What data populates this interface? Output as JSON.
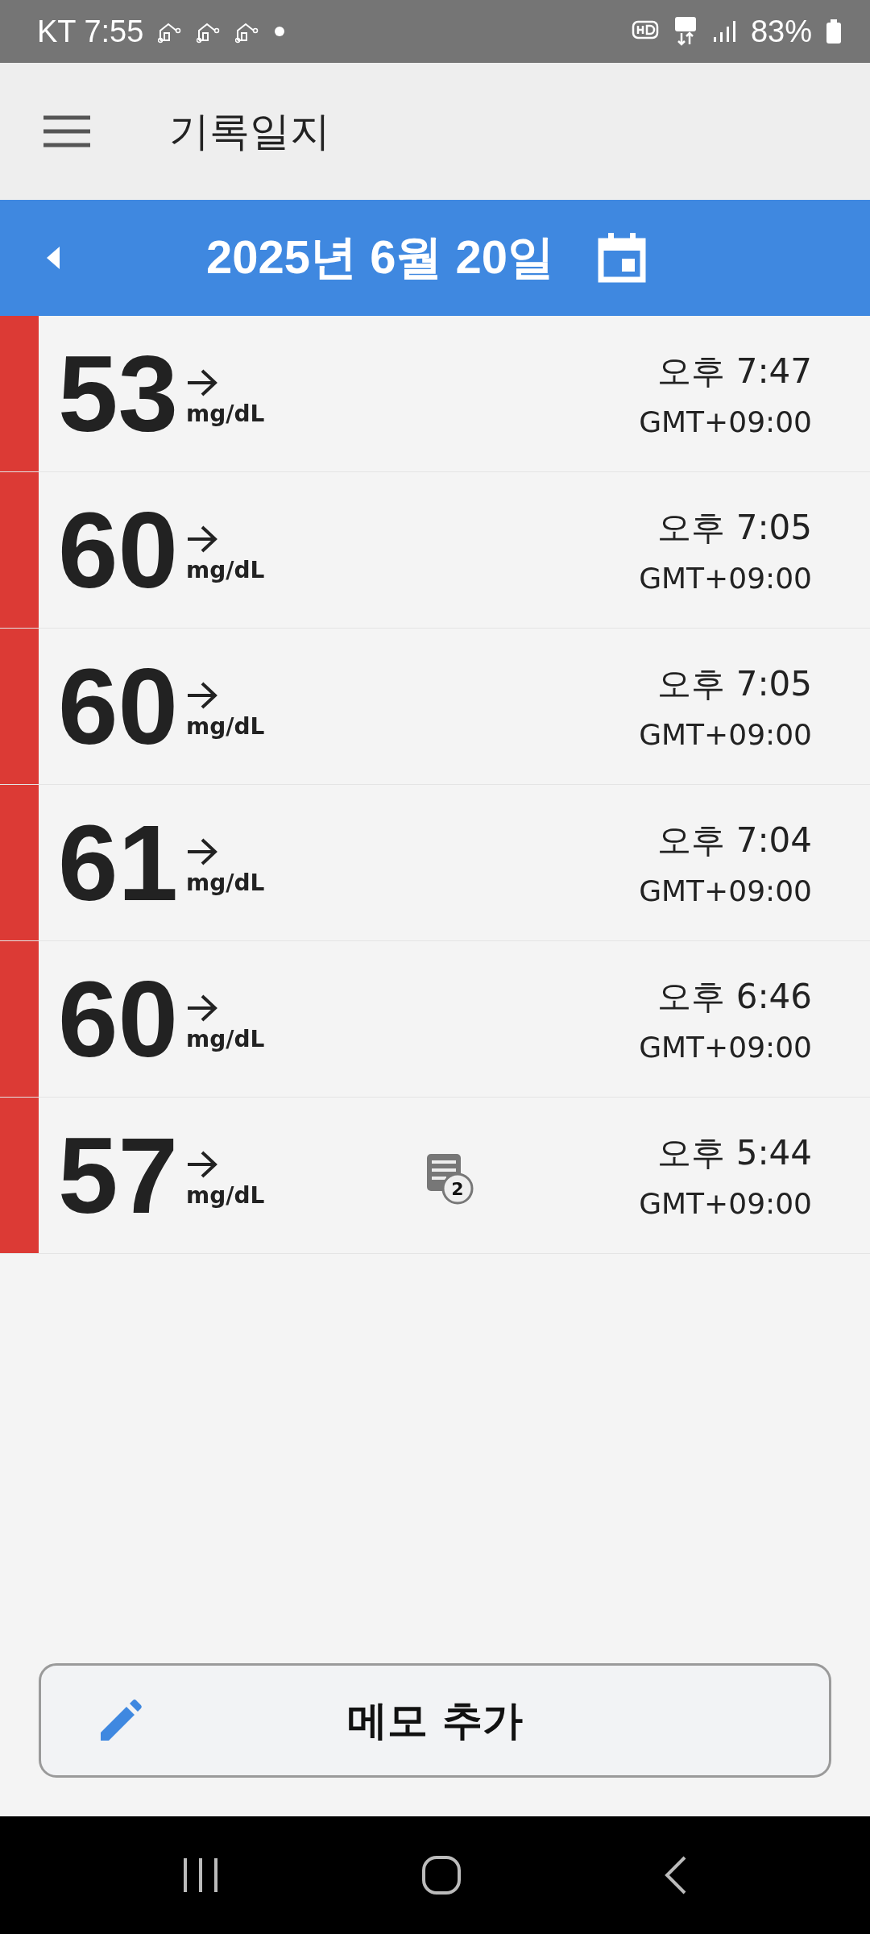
{
  "status_bar": {
    "carrier_time": "KT 7:55",
    "battery": "83%"
  },
  "app_bar": {
    "title": "기록일지"
  },
  "date_bar": {
    "date": "2025년 6월 20일"
  },
  "readings": [
    {
      "value": "53",
      "unit": "mg/dL",
      "time": "오후 7:47",
      "timezone": "GMT+09:00",
      "color": "#dc3a35"
    },
    {
      "value": "60",
      "unit": "mg/dL",
      "time": "오후 7:05",
      "timezone": "GMT+09:00",
      "color": "#dc3a35"
    },
    {
      "value": "60",
      "unit": "mg/dL",
      "time": "오후 7:05",
      "timezone": "GMT+09:00",
      "color": "#dc3a35"
    },
    {
      "value": "61",
      "unit": "mg/dL",
      "time": "오후 7:04",
      "timezone": "GMT+09:00",
      "color": "#dc3a35"
    },
    {
      "value": "60",
      "unit": "mg/dL",
      "time": "오후 6:46",
      "timezone": "GMT+09:00",
      "color": "#dc3a35"
    },
    {
      "value": "57",
      "unit": "mg/dL",
      "time": "오후 5:44",
      "timezone": "GMT+09:00",
      "color": "#dc3a35",
      "note_count": "2"
    }
  ],
  "add_memo_button": {
    "label": "메모 추가"
  }
}
